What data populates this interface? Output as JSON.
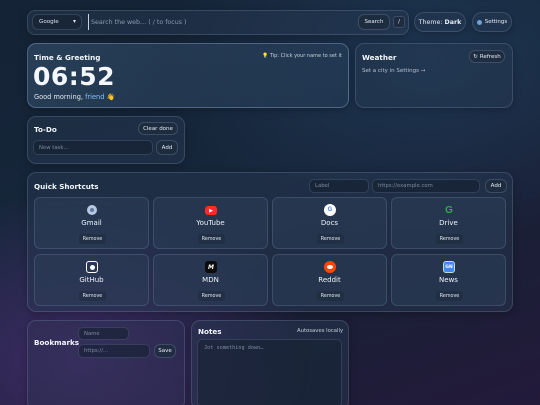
{
  "search": {
    "engine": "Google",
    "placeholder": "Search the web… ( / to focus )",
    "button": "Search",
    "shortcut_key": "/",
    "theme_prefix": "Theme:",
    "theme_value": "Dark",
    "settings": "Settings"
  },
  "clock": {
    "title": "Time & Greeting",
    "tip": "Tip: Click your name to set it",
    "time": "06:52",
    "greeting": "Good morning,",
    "name": "friend",
    "emoji": "👋"
  },
  "weather": {
    "title": "Weather",
    "refresh": "Refresh",
    "message": "Set a city in Settings →"
  },
  "todo": {
    "title": "To-Do",
    "clear": "Clear done",
    "placeholder": "New task…",
    "add": "Add"
  },
  "shortcuts": {
    "title": "Quick Shortcuts",
    "label_placeholder": "Label",
    "url_placeholder": "https://example.com",
    "add": "Add",
    "remove": "Remove",
    "items": [
      {
        "name": "Gmail",
        "icon": "globe-icon",
        "glyph": "◍",
        "color": "#c9d3e3"
      },
      {
        "name": "YouTube",
        "icon": "youtube-icon",
        "glyph": "▶",
        "color": "#ff2a2a"
      },
      {
        "name": "Docs",
        "icon": "google-icon",
        "glyph": "G",
        "color": "#ffffff"
      },
      {
        "name": "Drive",
        "icon": "google-icon",
        "glyph": "G",
        "color": "#ffffff"
      },
      {
        "name": "GitHub",
        "icon": "github-icon",
        "glyph": "◉",
        "color": "#ffffff"
      },
      {
        "name": "MDN",
        "icon": "mdn-icon",
        "glyph": "M",
        "color": "#111111"
      },
      {
        "name": "Reddit",
        "icon": "reddit-icon",
        "glyph": "●",
        "color": "#ff4500"
      },
      {
        "name": "News",
        "icon": "google-news-icon",
        "glyph": "GN",
        "color": "#4285f4"
      }
    ]
  },
  "bookmarks": {
    "title": "Bookmarks",
    "name_placeholder": "Name",
    "url_placeholder": "https://…",
    "save": "Save"
  },
  "notes": {
    "title": "Notes",
    "autosave": "Autosaves locally",
    "placeholder": "Jot something down…"
  }
}
